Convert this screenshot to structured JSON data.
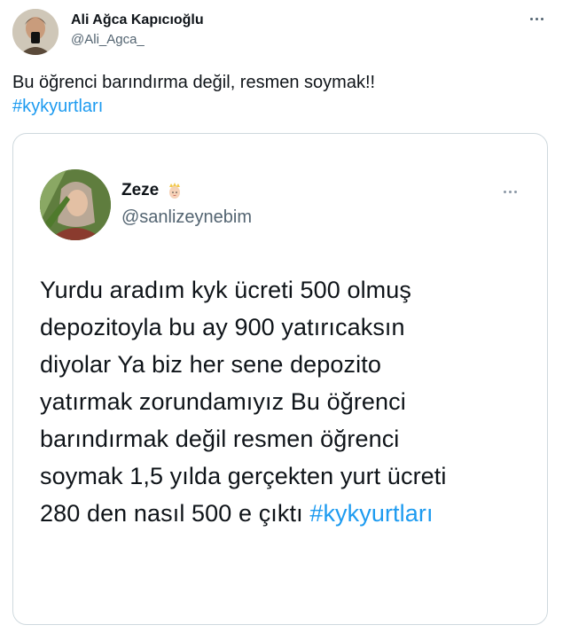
{
  "tweet": {
    "author_name": "Ali Ağca Kapıcıoğlu",
    "author_handle": "@Ali_Agca_",
    "text": "Bu öğrenci barındırma değil, resmen soymak!!",
    "hashtag": "#kykyurtları"
  },
  "quoted_tweet": {
    "author_name": "Zeze",
    "author_emoji": "princess-emoji",
    "author_handle": "@sanlizeynebim",
    "lines": [
      "Yurdu aradım kyk ücreti 500 olmuş",
      "depozitoyla bu ay 900 yatırıcaksın",
      "diyolar Ya biz her sene depozito",
      "yatırmak zorundamıyız Bu öğrenci",
      "barındırmak değil resmen öğrenci",
      "soymak 1,5 yılda gerçekten yurt ücreti",
      "280 den nasıl 500 e çıktı"
    ],
    "hashtag": "#kykyurtları"
  },
  "colors": {
    "link": "#1d9bf0",
    "text": "#0f1419",
    "secondary": "#536471",
    "border": "#cfd9de"
  }
}
